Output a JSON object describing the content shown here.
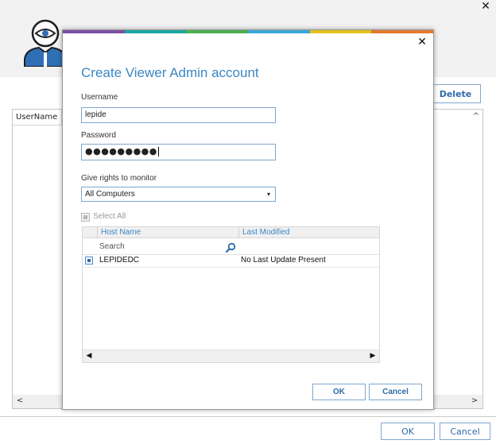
{
  "background_window": {
    "close_glyph": "✕",
    "avatar_icon": "user-eye-icon",
    "delete_label": "Delete",
    "column_username": "UserName",
    "scroll_up_glyph": "^",
    "scroll_left_glyph": "<",
    "scroll_right_glyph": ">",
    "ok_label": "OK",
    "cancel_label": "Cancel"
  },
  "dialog": {
    "close_glyph": "✕",
    "title": "Create Viewer Admin account",
    "stripe_colors": [
      "#7b4fa3",
      "#1aa7a0",
      "#4caf50",
      "#3aa6d6",
      "#e2c21c",
      "#e07a2e"
    ],
    "username_label": "Username",
    "username_value": "lepide",
    "password_label": "Password",
    "password_masked": "●●●●●●●●●",
    "rights_label": "Give rights to monitor",
    "rights_selected": "All Computers",
    "dropdown_glyph": "▾",
    "select_all_label": "Select All",
    "grid": {
      "columns": [
        "Host Name",
        "Last Modified"
      ],
      "search_placeholder": "Search",
      "rows": [
        {
          "host": "LEPIDEDC",
          "last_modified": "No Last Update Present",
          "checked": true
        }
      ],
      "scroll_left_glyph": "◀",
      "scroll_right_glyph": "▶"
    },
    "ok_label": "OK",
    "cancel_label": "Cancel"
  },
  "colors": {
    "accent_blue": "#3a86c4",
    "button_text": "#2e6ba9",
    "button_border": "#7fa7cf",
    "avatar_blue": "#2f6fb5"
  }
}
